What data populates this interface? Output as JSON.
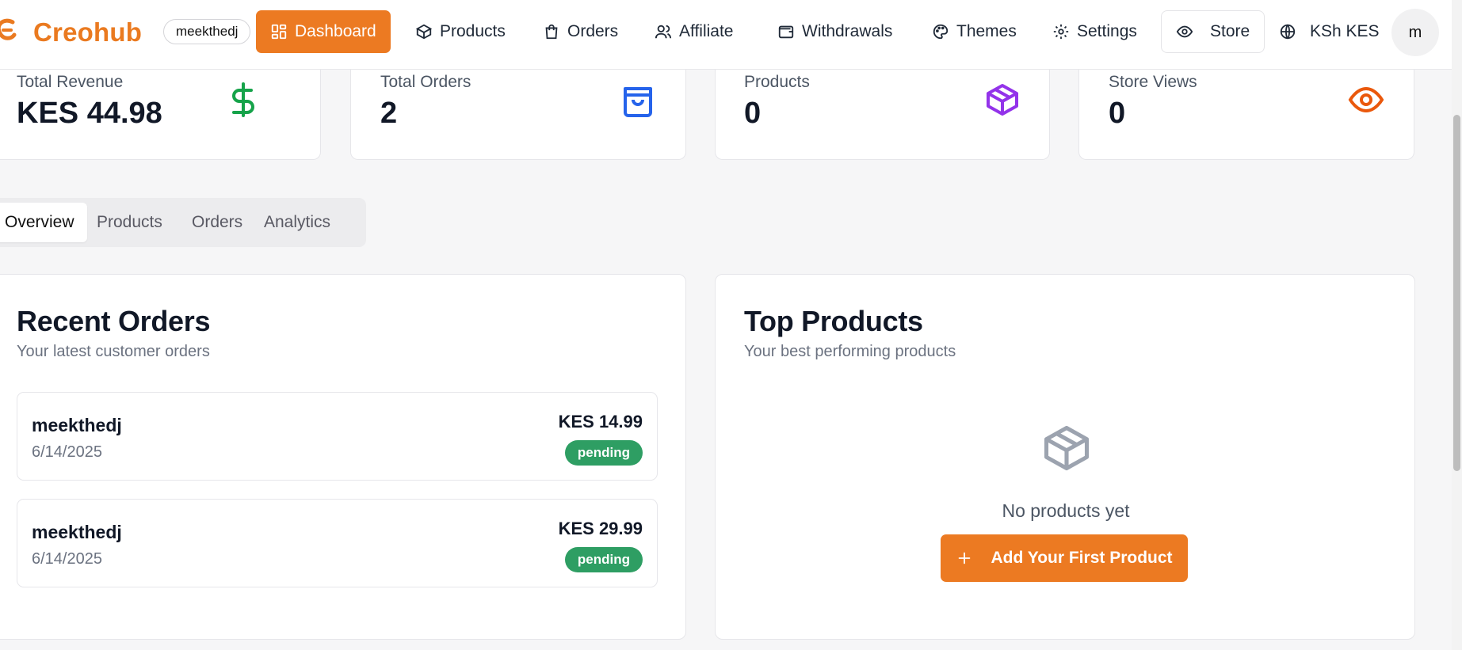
{
  "header": {
    "brand": "Creohub",
    "store_handle": "meekthedj",
    "nav": [
      {
        "label": "Dashboard",
        "icon": "dashboard-icon"
      },
      {
        "label": "Products",
        "icon": "box-icon"
      },
      {
        "label": "Orders",
        "icon": "shopping-bag-icon"
      },
      {
        "label": "Affiliate",
        "icon": "users-icon"
      },
      {
        "label": "Withdrawals",
        "icon": "wallet-icon"
      },
      {
        "label": "Themes",
        "icon": "palette-icon"
      },
      {
        "label": "Settings",
        "icon": "gear-icon"
      }
    ],
    "store_label": "Store",
    "currency_label": "KSh KES",
    "avatar_initial": "m"
  },
  "stats": [
    {
      "label": "Total Revenue",
      "value": "KES 44.98",
      "icon": "dollar-icon",
      "color": "#16a34a"
    },
    {
      "label": "Total Orders",
      "value": "2",
      "icon": "shopping-bag-icon",
      "color": "#2563eb"
    },
    {
      "label": "Products",
      "value": "0",
      "icon": "box-icon",
      "color": "#9333ea"
    },
    {
      "label": "Store Views",
      "value": "0",
      "icon": "eye-icon",
      "color": "#ea580c"
    }
  ],
  "tabs": [
    "Overview",
    "Products",
    "Orders",
    "Analytics"
  ],
  "recent_orders": {
    "title": "Recent Orders",
    "subtitle": "Your latest customer orders",
    "orders": [
      {
        "customer": "meekthedj",
        "date": "6/14/2025",
        "amount": "KES 14.99",
        "status": "pending"
      },
      {
        "customer": "meekthedj",
        "date": "6/14/2025",
        "amount": "KES 29.99",
        "status": "pending"
      }
    ]
  },
  "top_products": {
    "title": "Top Products",
    "subtitle": "Your best performing products",
    "empty_text": "No products yet",
    "add_button": "Add Your First Product"
  },
  "colors": {
    "accent": "#ec7a22",
    "badge": "#2e9e63"
  }
}
